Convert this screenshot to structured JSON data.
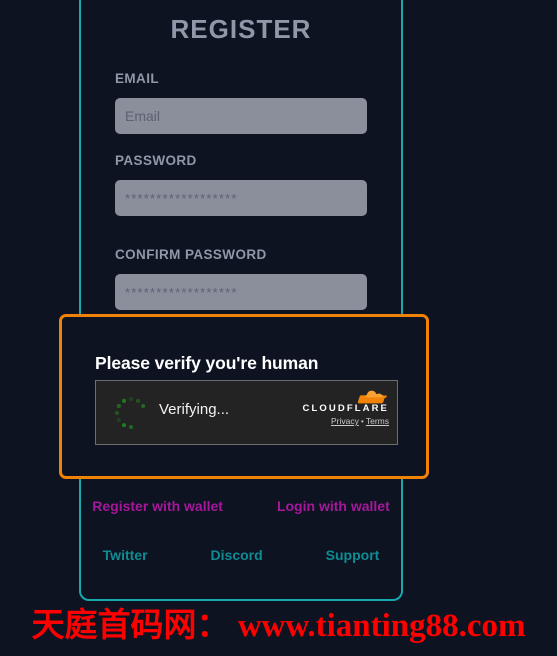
{
  "page": {
    "title": "REGISTER",
    "background_color": "#0d1321",
    "card_border_color": "#17a8ad"
  },
  "form": {
    "fields": [
      {
        "label": "EMAIL",
        "placeholder": "Email",
        "value": "",
        "name": "email"
      },
      {
        "label": "PASSWORD",
        "placeholder": "******************",
        "value": "",
        "name": "password"
      },
      {
        "label": "CONFIRM PASSWORD",
        "placeholder": "******************",
        "value": "",
        "name": "confirm-password"
      }
    ]
  },
  "wallet_links": [
    {
      "label": "Register with wallet",
      "color": "#a5179b"
    },
    {
      "label": "Login with wallet",
      "color": "#a5179b"
    }
  ],
  "social_links": [
    {
      "label": "Twitter",
      "color": "#0f8c93"
    },
    {
      "label": "Discord",
      "color": "#0f8c93"
    },
    {
      "label": "Support",
      "color": "#0f8c93"
    }
  ],
  "verify_modal": {
    "border_color": "#f08208",
    "heading": "Please verify you're human",
    "widget": {
      "status_text": "Verifying...",
      "spinner_color": "#1f7a1f",
      "brand_name": "CLOUDFLARE",
      "brand_color": "#f08208",
      "privacy_label": "Privacy",
      "separator": "•",
      "terms_label": "Terms"
    }
  },
  "watermark": {
    "text": "天庭首码网： www.tianting88.com",
    "color": "#fe0000"
  }
}
